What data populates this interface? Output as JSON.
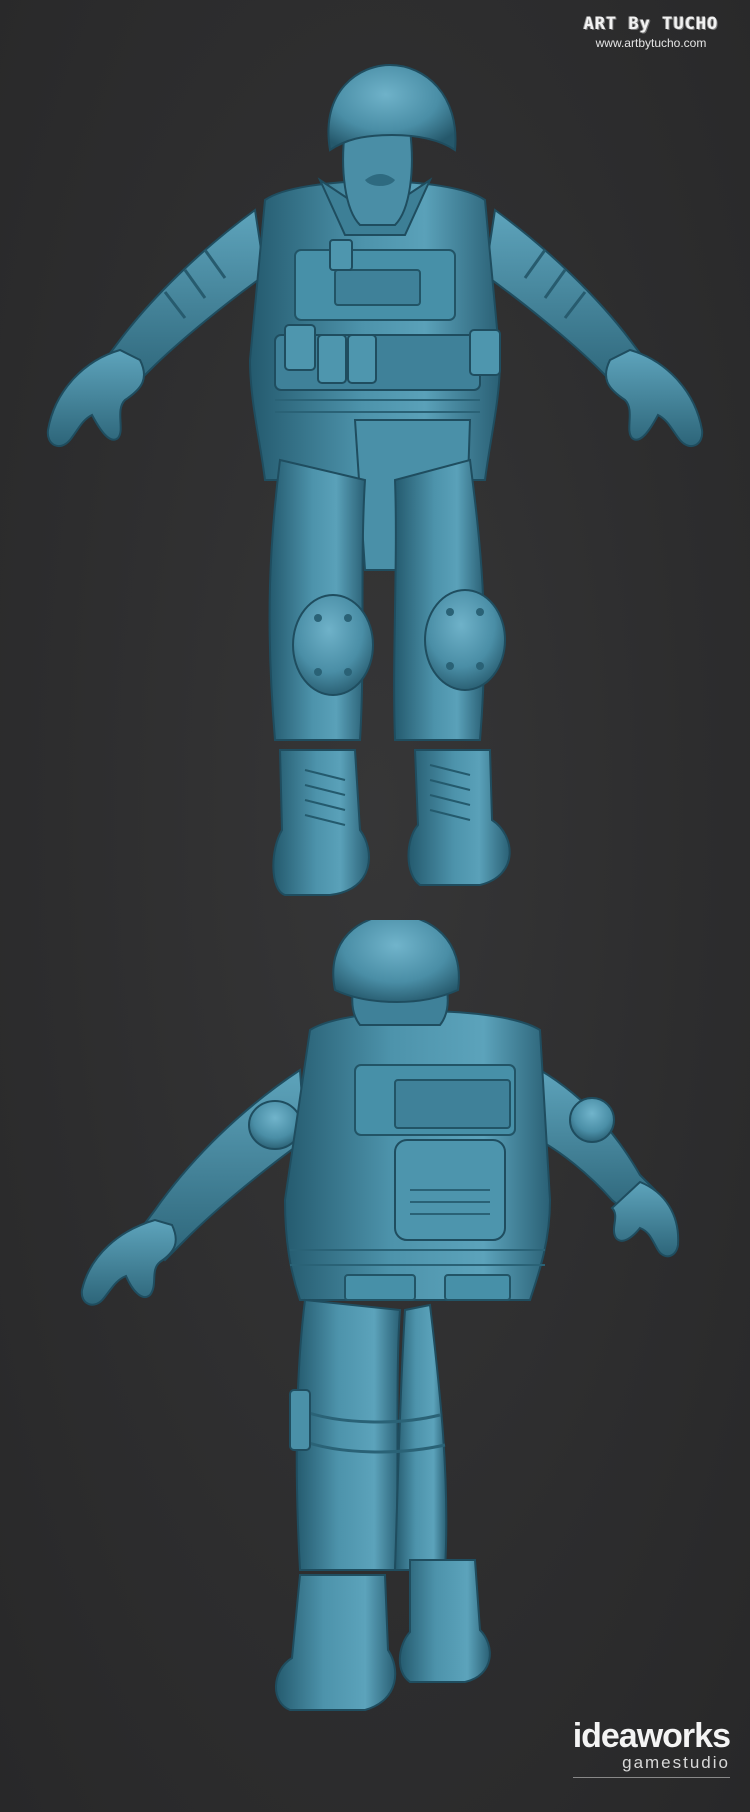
{
  "branding": {
    "artist_logo": "ART By TUCHO",
    "artist_url": "www.artbytucho.com",
    "studio_name": "ideaworks",
    "studio_subtitle": "gamestudio"
  },
  "colors": {
    "background": "#2e2e2f",
    "model_base": "#4a8fa8",
    "model_dark": "#1f4f62",
    "model_light": "#7fc0d6"
  },
  "views": [
    {
      "id": "front",
      "icon": "soldier-front-render"
    },
    {
      "id": "back",
      "icon": "soldier-back-render"
    }
  ]
}
